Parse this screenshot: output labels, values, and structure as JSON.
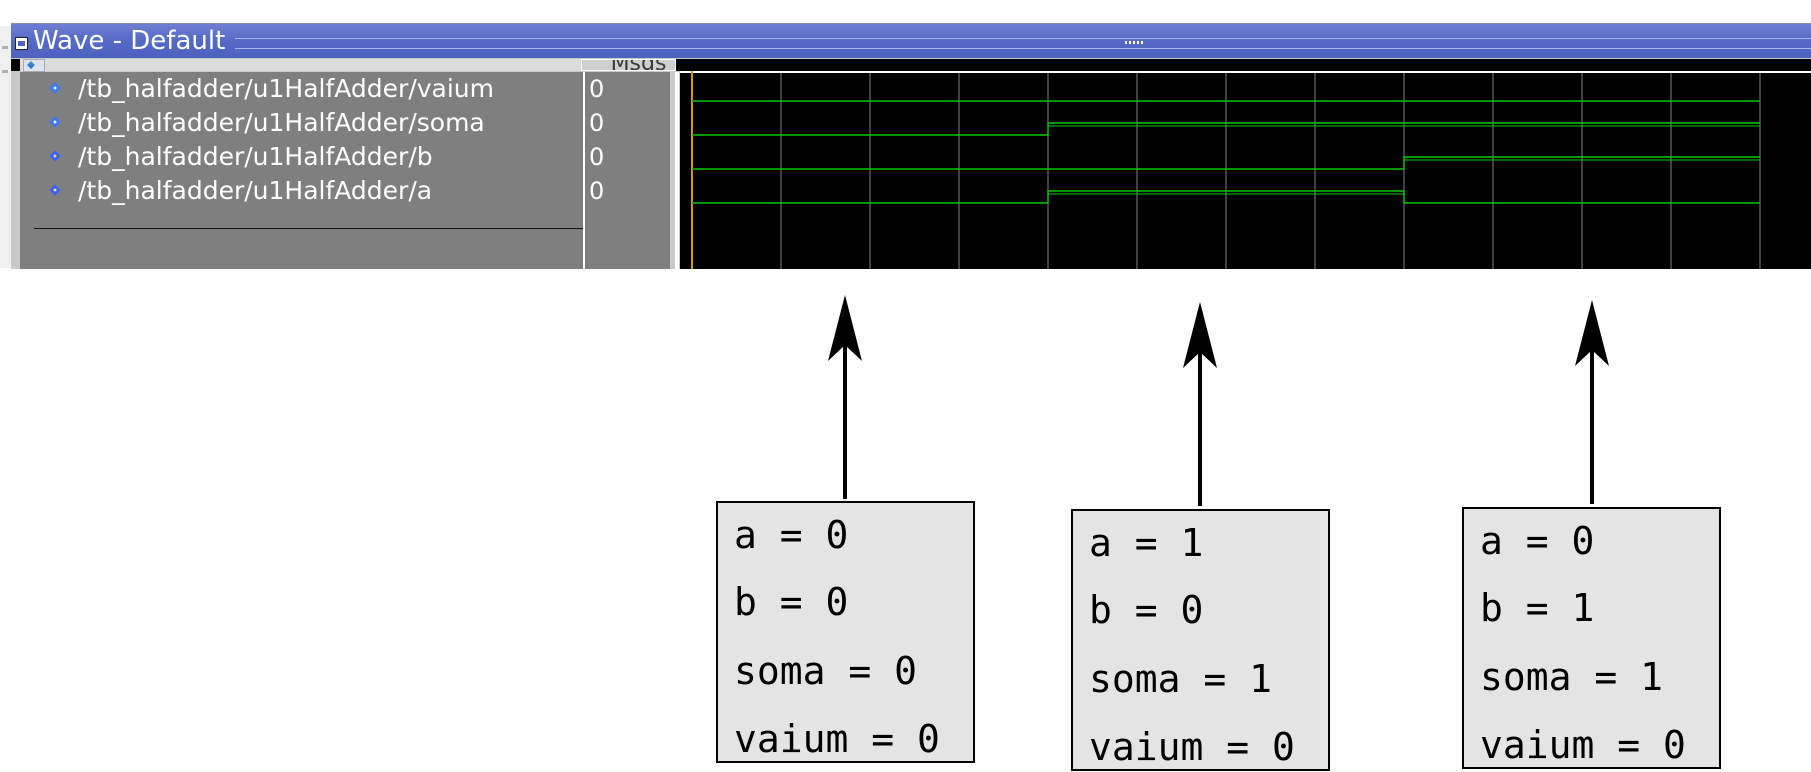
{
  "window": {
    "title": "Wave - Default"
  },
  "header": {
    "msgs_label": "Msgs"
  },
  "signals": [
    {
      "name": "/tb_halfadder/u1HalfAdder/vaium",
      "value": "0"
    },
    {
      "name": "/tb_halfadder/u1HalfAdder/soma",
      "value": "0"
    },
    {
      "name": "/tb_halfadder/u1HalfAdder/b",
      "value": "0"
    },
    {
      "name": "/tb_halfadder/u1HalfAdder/a",
      "value": "0"
    }
  ],
  "waveform": {
    "color": "#00c800",
    "grid_color": "#808080",
    "cursor_color": "#c8a000",
    "time_steps": 12,
    "traces": [
      {
        "signal": "vaium",
        "levels": [
          0,
          0,
          0,
          0,
          0,
          0,
          0,
          0,
          0,
          0,
          0,
          0
        ]
      },
      {
        "signal": "soma",
        "levels": [
          0,
          0,
          0,
          0,
          1,
          1,
          1,
          1,
          1,
          1,
          1,
          1
        ]
      },
      {
        "signal": "b",
        "levels": [
          0,
          0,
          0,
          0,
          0,
          0,
          0,
          0,
          1,
          1,
          1,
          1
        ]
      },
      {
        "signal": "a",
        "levels": [
          0,
          0,
          0,
          0,
          1,
          1,
          1,
          1,
          0,
          0,
          0,
          0
        ]
      }
    ]
  },
  "annotations": [
    {
      "lines": [
        "a = 0",
        "b = 0",
        "soma = 0",
        "vaium = 0"
      ]
    },
    {
      "lines": [
        "a = 1",
        "b = 0",
        "soma = 1",
        "vaium = 0"
      ]
    },
    {
      "lines": [
        "a = 0",
        "b = 1",
        "soma = 1",
        "vaium = 0"
      ]
    }
  ]
}
